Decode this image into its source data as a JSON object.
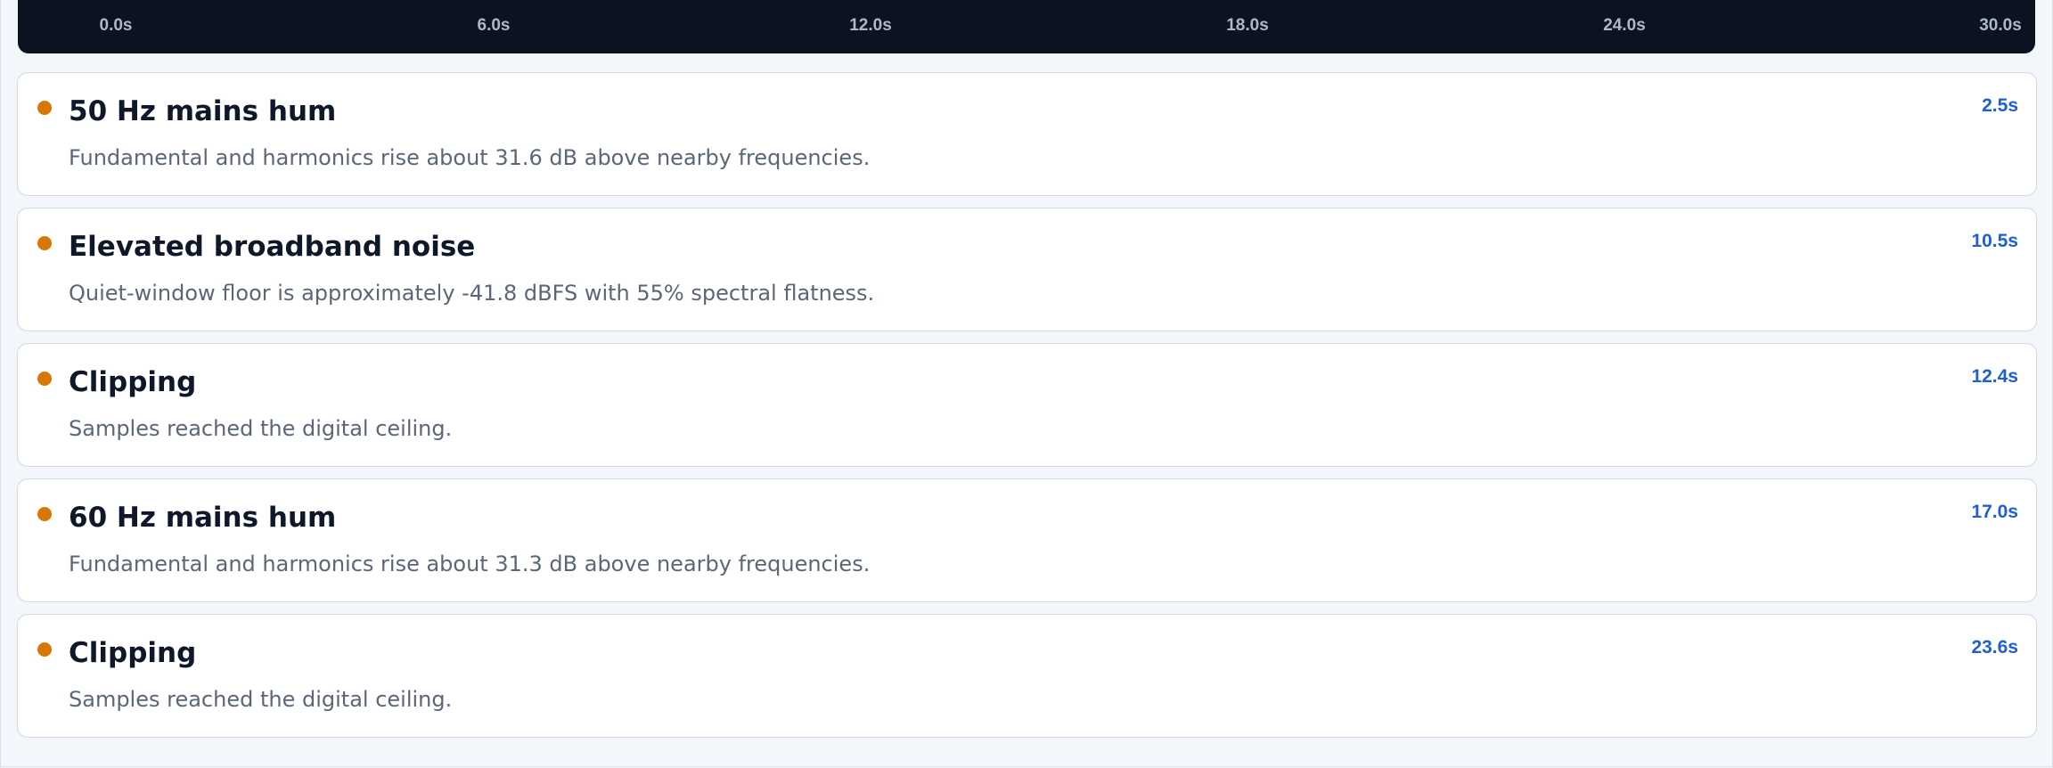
{
  "timeline": {
    "ticks": [
      "0.0s",
      "6.0s",
      "12.0s",
      "18.0s",
      "24.0s",
      "30.0s"
    ]
  },
  "events": [
    {
      "title": "50 Hz mains hum",
      "description": "Fundamental and harmonics rise about 31.6 dB above nearby frequencies.",
      "time": "2.5s"
    },
    {
      "title": "Elevated broadband noise",
      "description": "Quiet-window floor is approximately -41.8 dBFS with 55% spectral flatness.",
      "time": "10.5s"
    },
    {
      "title": "Clipping",
      "description": "Samples reached the digital ceiling.",
      "time": "12.4s"
    },
    {
      "title": "60 Hz mains hum",
      "description": "Fundamental and harmonics rise about 31.3 dB above nearby frequencies.",
      "time": "17.0s"
    },
    {
      "title": "Clipping",
      "description": "Samples reached the digital ceiling.",
      "time": "23.6s"
    }
  ],
  "colors": {
    "timeline_bg": "#0b1220",
    "marker": "#d97706",
    "time_accent": "#1d5fd6"
  },
  "icons": {
    "event_marker": "dot-icon"
  }
}
